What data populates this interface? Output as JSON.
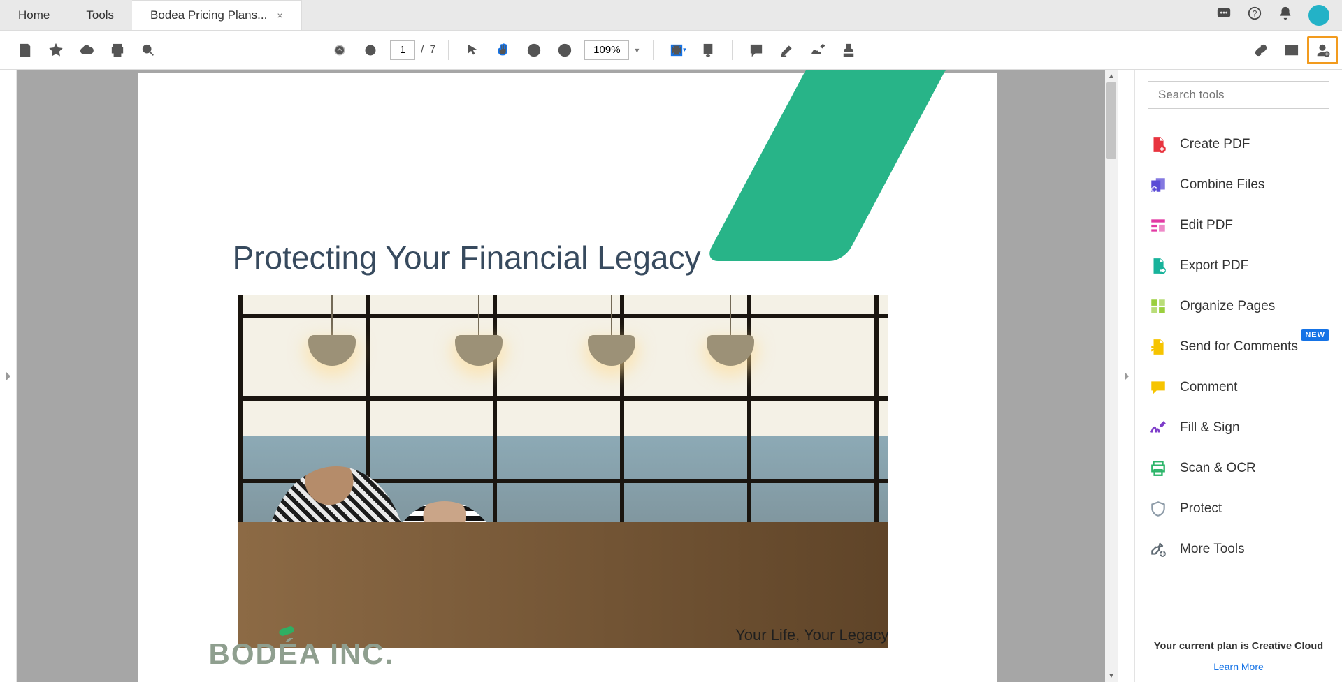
{
  "tabs": {
    "home": "Home",
    "tools": "Tools",
    "doc": "Bodea Pricing Plans...",
    "close": "×"
  },
  "toolbar": {
    "page_current": "1",
    "page_sep": "/",
    "page_total": "7",
    "zoom": "109%"
  },
  "document": {
    "title": "Protecting Your Financial Legacy",
    "company": "BODÉA INC.",
    "tagline": "Your Life, Your Legacy"
  },
  "panel": {
    "search_placeholder": "Search tools",
    "tools": [
      {
        "label": "Create PDF",
        "icon": "create-pdf",
        "color": "#e8343f"
      },
      {
        "label": "Combine Files",
        "icon": "combine",
        "color": "#5a4bd6"
      },
      {
        "label": "Edit PDF",
        "icon": "edit-pdf",
        "color": "#e23aa4"
      },
      {
        "label": "Export PDF",
        "icon": "export-pdf",
        "color": "#18b39b"
      },
      {
        "label": "Organize Pages",
        "icon": "organize",
        "color": "#9bcf3e"
      },
      {
        "label": "Send for Comments",
        "icon": "send-comments",
        "color": "#f6c400",
        "badge": "NEW"
      },
      {
        "label": "Comment",
        "icon": "comment",
        "color": "#f6c400"
      },
      {
        "label": "Fill & Sign",
        "icon": "fill-sign",
        "color": "#7d3cc9"
      },
      {
        "label": "Scan & OCR",
        "icon": "scan-ocr",
        "color": "#2db56a"
      },
      {
        "label": "Protect",
        "icon": "protect",
        "color": "#8c9aa7"
      },
      {
        "label": "More Tools",
        "icon": "more-tools",
        "color": "#5f6a73"
      }
    ],
    "plan_text": "Your current plan is Creative Cloud",
    "learn_more": "Learn More"
  }
}
